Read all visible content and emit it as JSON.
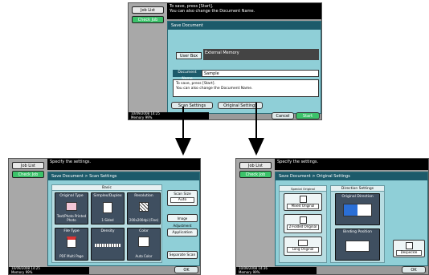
{
  "top": {
    "job_list": "Job List",
    "check_job": "Check Job",
    "message_line1": "To save, press [Start].",
    "message_line2": "You can also change the Document Name.",
    "panel_title": "Save Document",
    "user_box_label": "User Box",
    "user_box_value": "External Memory",
    "document_name_label": "Document Name",
    "document_name_value": "Sample",
    "info_line1": "To save, press [Start].",
    "info_line2": "You can also change the Document Name.",
    "scan_settings": "Scan Settings",
    "original_settings": "Original Settings",
    "cancel": "Cancel",
    "start": "Start",
    "date": "10/09/2008",
    "time": "14:25",
    "memory_label": "Memory",
    "memory_value": "99%"
  },
  "left": {
    "job_list": "Job List",
    "check_job": "Check Job",
    "message": "Specify the settings.",
    "panel_title": "Save Document > Scan Settings",
    "basic_header": "Basic",
    "tiles": [
      {
        "label": "Original Type",
        "value": "Text/Photo Printed Photo"
      },
      {
        "label": "Simplex/Duplex",
        "value": "1-Sided"
      },
      {
        "label": "Resolution",
        "value": "200x200dpi (Fine)"
      },
      {
        "label": "File Type",
        "value": "PDF Multi Page"
      },
      {
        "label": "Density",
        "value": ""
      },
      {
        "label": "Color",
        "value": "Auto Color"
      }
    ],
    "scan_size_label": "Scan Size",
    "scan_size_value": "Auto",
    "image_adjustment": "Image Adjustment",
    "application": "Application",
    "separate_scan": "Separate Scan",
    "ok": "OK",
    "date": "10/09/2008",
    "time": "14:25",
    "memory_label": "Memory",
    "memory_value": "99%"
  },
  "right": {
    "job_list": "Job List",
    "check_job": "Check Job",
    "message": "Specify the settings.",
    "panel_title": "Save Document > Original Settings",
    "special_original_header": "Special Original",
    "mixed_original": "Mixed Original",
    "z_folded": "Z-Folded Original",
    "long_original": "Long Original",
    "direction_header": "Direction Settings",
    "original_direction": "Original Direction",
    "binding_position": "Binding Position",
    "despeckle": "Despeckle",
    "ok": "OK",
    "date": "10/09/2008",
    "time": "14:36",
    "memory_label": "Memory",
    "memory_value": "99%"
  }
}
